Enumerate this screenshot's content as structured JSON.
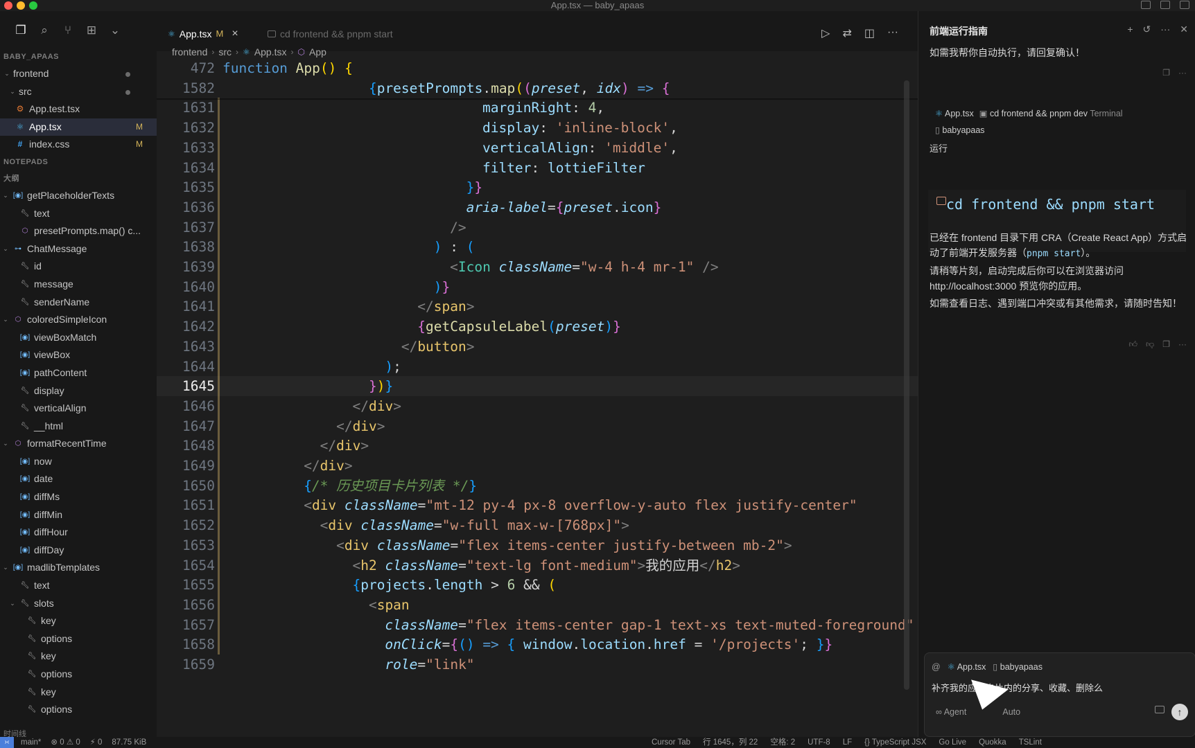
{
  "window": {
    "title": "App.tsx — baby_apaas"
  },
  "activity_bar": {
    "icons": [
      "explorer-icon",
      "search-icon",
      "source-control-icon",
      "extensions-icon",
      "chevron-down-icon"
    ]
  },
  "explorer": {
    "root": "BABY_APAAS",
    "items": [
      {
        "label": "frontend",
        "kind": "folder",
        "modified_dot": true
      },
      {
        "label": "src",
        "kind": "folder",
        "modified_dot": true
      },
      {
        "label": "App.test.tsx",
        "kind": "file"
      },
      {
        "label": "App.tsx",
        "kind": "file",
        "badge": "M"
      },
      {
        "label": "index.css",
        "kind": "file",
        "badge": "M"
      }
    ]
  },
  "notepads": {
    "title": "NOTEPADS"
  },
  "outline": {
    "title": "大纲",
    "items": [
      {
        "label": "getPlaceholderTexts",
        "icon": "field-icon",
        "level": 0,
        "chev": "v"
      },
      {
        "label": "text",
        "icon": "property-icon",
        "level": 1
      },
      {
        "label": "presetPrompts.map() c...",
        "icon": "method-icon",
        "level": 1
      },
      {
        "label": "ChatMessage",
        "icon": "interface-icon",
        "level": 0,
        "chev": "v"
      },
      {
        "label": "id",
        "icon": "property-icon",
        "level": 1
      },
      {
        "label": "message",
        "icon": "property-icon",
        "level": 1
      },
      {
        "label": "senderName",
        "icon": "property-icon",
        "level": 1
      },
      {
        "label": "coloredSimpleIcon",
        "icon": "method-icon",
        "level": 0,
        "chev": "v"
      },
      {
        "label": "viewBoxMatch",
        "icon": "field-icon",
        "level": 1
      },
      {
        "label": "viewBox",
        "icon": "field-icon",
        "level": 1
      },
      {
        "label": "pathContent",
        "icon": "field-icon",
        "level": 1
      },
      {
        "label": "display",
        "icon": "property-icon",
        "level": 1
      },
      {
        "label": "verticalAlign",
        "icon": "property-icon",
        "level": 1
      },
      {
        "label": "__html",
        "icon": "property-icon",
        "level": 1
      },
      {
        "label": "formatRecentTime",
        "icon": "method-icon",
        "level": 0,
        "chev": "v"
      },
      {
        "label": "now",
        "icon": "field-icon",
        "level": 1
      },
      {
        "label": "date",
        "icon": "field-icon",
        "level": 1
      },
      {
        "label": "diffMs",
        "icon": "field-icon",
        "level": 1
      },
      {
        "label": "diffMin",
        "icon": "field-icon",
        "level": 1
      },
      {
        "label": "diffHour",
        "icon": "field-icon",
        "level": 1
      },
      {
        "label": "diffDay",
        "icon": "field-icon",
        "level": 1
      },
      {
        "label": "madlibTemplates",
        "icon": "field-icon",
        "level": 0,
        "chev": "v"
      },
      {
        "label": "text",
        "icon": "property-icon",
        "level": 1
      },
      {
        "label": "slots",
        "icon": "property-icon",
        "level": 1,
        "chev": "v"
      },
      {
        "label": "key",
        "icon": "property-icon",
        "level": 2
      },
      {
        "label": "options",
        "icon": "property-icon",
        "level": 2
      },
      {
        "label": "key",
        "icon": "property-icon",
        "level": 2
      },
      {
        "label": "options",
        "icon": "property-icon",
        "level": 2
      },
      {
        "label": "key",
        "icon": "property-icon",
        "level": 2
      },
      {
        "label": "options",
        "icon": "property-icon",
        "level": 2
      }
    ],
    "timeline_title": "时间线"
  },
  "tabs": [
    {
      "label": "App.tsx",
      "status": "M",
      "close": "×",
      "active": true
    },
    {
      "label": "cd frontend && pnpm start",
      "active": false
    }
  ],
  "breadcrumb": [
    "frontend",
    "src",
    "App.tsx",
    "App"
  ],
  "code": {
    "current_line": 1645,
    "lines": [
      {
        "n": 472,
        "html": "<span class='kw'>function</span> <span class='f'>App</span><span class='b1'>()</span> <span class='b1'>{</span>",
        "indent": 0
      },
      {
        "n": 1582,
        "html": "<span class='b3'>{</span><span class='v'>presetPrompts</span>.<span class='f'>map</span><span class='b1'>(</span><span class='b2'>(</span><span class='vi'>preset</span>, <span class='vi'>idx</span><span class='b2'>)</span> <span class='kw'>=&gt;</span> <span class='b2'>{</span>",
        "indent": 18
      },
      {
        "n": 1631,
        "html": "<span class='v'>marginRight</span>: <span class='n'>4</span>,",
        "indent": 32
      },
      {
        "n": 1632,
        "html": "<span class='v'>display</span>: <span class='s'>'inline-block'</span>,",
        "indent": 32
      },
      {
        "n": 1633,
        "html": "<span class='v'>verticalAlign</span>: <span class='s'>'middle'</span>,",
        "indent": 32
      },
      {
        "n": 1634,
        "html": "<span class='v'>filter</span>: <span class='v'>lottieFilter</span>",
        "indent": 32
      },
      {
        "n": 1635,
        "html": "<span class='b3'>}</span><span class='b2'>}</span>",
        "indent": 30
      },
      {
        "n": 1636,
        "html": "<span class='at'>aria-label</span>=<span class='b2'>{</span><span class='vi'>preset</span>.<span class='v'>icon</span><span class='b2'>}</span>",
        "indent": 30
      },
      {
        "n": 1637,
        "html": "<span class='tag'>/&gt;</span>",
        "indent": 28
      },
      {
        "n": 1638,
        "html": "<span class='b3'>)</span> <span class='p'>:</span> <span class='b3'>(</span>",
        "indent": 26
      },
      {
        "n": 1639,
        "html": "<span class='tag'>&lt;</span><span class='tg'>Icon</span> <span class='at'>className</span>=<span class='s'>\"w-4 h-4 mr-1\"</span> <span class='tag'>/&gt;</span>",
        "indent": 28
      },
      {
        "n": 1640,
        "html": "<span class='b3'>)</span><span class='b2'>}</span>",
        "indent": 26
      },
      {
        "n": 1641,
        "html": "<span class='tag'>&lt;/</span><span class='cn'>span</span><span class='tag'>&gt;</span>",
        "indent": 24
      },
      {
        "n": 1642,
        "html": "<span class='b2'>{</span><span class='f'>getCapsuleLabel</span><span class='b3'>(</span><span class='vi'>preset</span><span class='b3'>)</span><span class='b2'>}</span>",
        "indent": 24
      },
      {
        "n": 1643,
        "html": "<span class='tag'>&lt;/</span><span class='cn'>button</span><span class='tag'>&gt;</span>",
        "indent": 22
      },
      {
        "n": 1644,
        "html": "<span class='b3'>)</span>;",
        "indent": 20
      },
      {
        "n": 1645,
        "html": "<span class='b2'>}</span><span class='b1'>)</span><span class='b3'>}</span>",
        "indent": 18
      },
      {
        "n": 1646,
        "html": "<span class='tag'>&lt;/</span><span class='cn'>div</span><span class='tag'>&gt;</span>",
        "indent": 16
      },
      {
        "n": 1647,
        "html": "<span class='tag'>&lt;/</span><span class='cn'>div</span><span class='tag'>&gt;</span>",
        "indent": 14
      },
      {
        "n": 1648,
        "html": "<span class='tag'>&lt;/</span><span class='cn'>div</span><span class='tag'>&gt;</span>",
        "indent": 12
      },
      {
        "n": 1649,
        "html": "<span class='tag'>&lt;/</span><span class='cn'>div</span><span class='tag'>&gt;</span>",
        "indent": 10
      },
      {
        "n": 1650,
        "html": "<span class='b3'>{</span><span class='cm'>/* 历史项目卡片列表 */</span><span class='b3'>}</span>",
        "indent": 10
      },
      {
        "n": 1651,
        "html": "<span class='tag'>&lt;</span><span class='cn'>div</span> <span class='at'>className</span>=<span class='s'>\"mt-12 py-4 px-8 overflow-y-auto flex justify-center\"</span>",
        "indent": 10
      },
      {
        "n": 1652,
        "html": "<span class='tag'>&lt;</span><span class='cn'>div</span> <span class='at'>className</span>=<span class='s'>\"w-full max-w-[768px]\"</span><span class='tag'>&gt;</span>",
        "indent": 12
      },
      {
        "n": 1653,
        "html": "<span class='tag'>&lt;</span><span class='cn'>div</span> <span class='at'>className</span>=<span class='s'>\"flex items-center justify-between mb-2\"</span><span class='tag'>&gt;</span>",
        "indent": 14
      },
      {
        "n": 1654,
        "html": "<span class='tag'>&lt;</span><span class='cn'>h2</span> <span class='at'>className</span>=<span class='s'>\"text-lg font-medium\"</span><span class='tag'>&gt;</span>我的应用<span class='tag'>&lt;/</span><span class='cn'>h2</span><span class='tag'>&gt;</span>",
        "indent": 16
      },
      {
        "n": 1655,
        "html": "<span class='b3'>{</span><span class='v'>projects</span>.<span class='v'>length</span> &gt; <span class='n'>6</span> &amp;&amp; <span class='b1'>(</span>",
        "indent": 16
      },
      {
        "n": 1656,
        "html": "<span class='tag'>&lt;</span><span class='cn'>span</span>",
        "indent": 18
      },
      {
        "n": 1657,
        "html": "<span class='at'>className</span>=<span class='s'>\"flex items-center gap-1 text-xs text-muted-foreground\"</span>",
        "indent": 20
      },
      {
        "n": 1658,
        "html": "<span class='at'>onClick</span>=<span class='b2'>{</span><span class='b3'>()</span> <span class='kw'>=&gt;</span> <span class='b3'>{</span> <span class='v'>window</span>.<span class='v'>location</span>.<span class='v'>href</span> = <span class='s'>'/projects'</span>; <span class='b3'>}</span><span class='b2'>}</span>",
        "indent": 20
      },
      {
        "n": 1659,
        "html": "<span class='at'>role</span>=<span class='s'>\"link\"</span>",
        "indent": 20
      }
    ]
  },
  "chat": {
    "title": "前端运行指南",
    "intro": "如需我帮你自动执行，请回复确认！",
    "context": {
      "file": "App.tsx",
      "terminal_cmd": "cd frontend && pnpm dev",
      "terminal_label": "Terminal",
      "repo": "babyapaas"
    },
    "run_label": "运行",
    "command": "cd frontend && pnpm start",
    "response_1a": "已经在 frontend 目录下用 CRA（Create React App）方式启动了前端开发服务器（",
    "response_1_code": "pnpm start",
    "response_1b": "）。",
    "response_2": "请稍等片刻，启动完成后你可以在浏览器访问 http://localhost:3000 预览你的应用。",
    "response_3": "如需查看日志、遇到端口冲突或有其他需求，请随时告知！",
    "input": {
      "at": "@",
      "ctx_file": "App.tsx",
      "ctx_repo": "babyapaas",
      "text": "补齐我的应用卡片内的分享、收藏、删除么",
      "mode": "∞ Agent",
      "model": "Auto"
    }
  },
  "statusbar": {
    "left": [
      "main*",
      "⊗ 0 ⚠ 0",
      "⚡ 0",
      "87.75 KiB"
    ],
    "right": [
      "Cursor Tab",
      "行 1645，列 22",
      "空格: 2",
      "UTF-8",
      "LF",
      "{} TypeScript JSX",
      "Go Live",
      "Quokka",
      "TSLint"
    ]
  },
  "colors": {
    "accent": "#4c7fdb",
    "modified": "#d4b45a",
    "editor_bg": "#1e1e1e",
    "sidebar_bg": "#181818"
  }
}
